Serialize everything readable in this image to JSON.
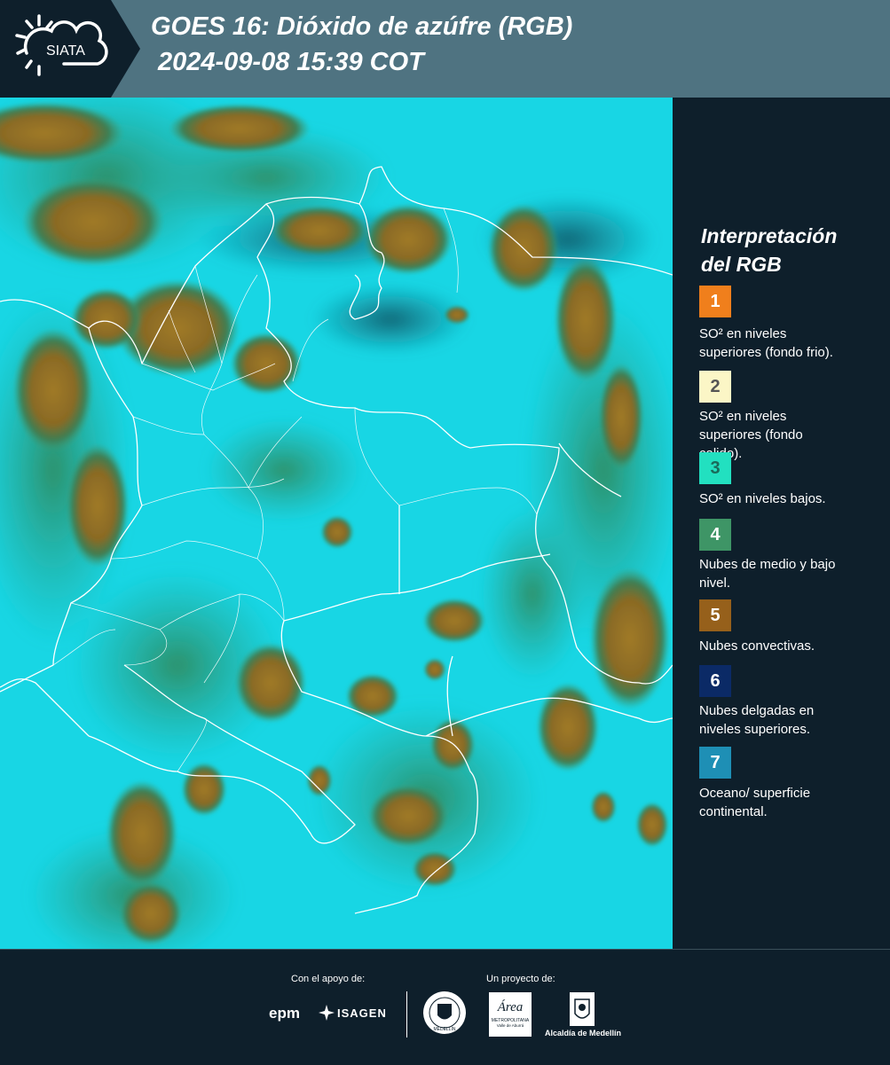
{
  "header": {
    "logo_text": "SIATA",
    "title_line1": "GOES 16: Dióxido de azúfre (RGB)",
    "title_line2": "2024-09-08 15:39 COT"
  },
  "legend": {
    "title_line1": "Interpretación",
    "title_line2": "del RGB",
    "items": [
      {
        "number": "1",
        "color": "#f07f1c",
        "text_line1": "SO² en niveles",
        "text_line2": "superiores (fondo frio)."
      },
      {
        "number": "2",
        "color": "#fbf6c6",
        "text_line1": "SO² en niveles",
        "text_line2": "superiores (fondo",
        "text_line3": "calido)."
      },
      {
        "number": "3",
        "color": "#22e0c0",
        "text_line1": "SO² en niveles bajos."
      },
      {
        "number": "4",
        "color": "#3e9566",
        "text_line1": "Nubes de medio y bajo",
        "text_line2": "nivel."
      },
      {
        "number": "5",
        "color": "#96601b",
        "text_line1": "Nubes convectivas."
      },
      {
        "number": "6",
        "color": "#0b2a66",
        "text_line1": "Nubes delgadas en",
        "text_line2": "niveles superiores."
      },
      {
        "number": "7",
        "color": "#1e8fb5",
        "text_line1": "Oceano/ superficie",
        "text_line2": "continental."
      }
    ]
  },
  "footer": {
    "support_label": "Con el apoyo de:",
    "project_label": "Un proyecto de:",
    "sponsor1": "epm",
    "sponsor2": "ISAGEN",
    "seal_text": "MEDELLÍN",
    "area_logo_script": "Área",
    "area_logo_line1": "METROPOLITANA",
    "area_logo_line2": "Valle de Aburrá",
    "alcaldia_label": "Alcaldía de Medellín"
  }
}
